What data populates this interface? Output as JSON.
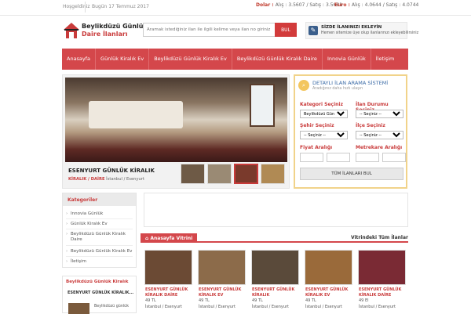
{
  "topbar": {
    "greeting": "Hoşgeldiniz",
    "date": "Bugün 17 Temmuz 2017",
    "dollar": {
      "label": "Dolar :",
      "buy_label": "Alış :",
      "buy": "3.5607",
      "sell_label": "/ Satış :",
      "sell": "3.5681"
    },
    "euro": {
      "label": "Euro :",
      "buy_label": "Alış :",
      "buy": "4.0644",
      "sell_label": "/ Satış :",
      "sell": "4.0744"
    }
  },
  "logo": {
    "line1": "Beylikdüzü Günlük",
    "line2": "Daire İlanları"
  },
  "search": {
    "placeholder": "Aramak istediğiniz ilan ile ilgili kelime veya ilan no giriniz",
    "button": "BUL"
  },
  "add_listing": {
    "title": "SİZDE İLANINIZI EKLEYİN",
    "text": "Hemen sitemize üye olup ilanlarınızı ekleyebilirsiniz"
  },
  "nav": [
    "Anasayfa",
    "Günlük Kiralık Ev",
    "Beylikdüzü Günlük Kiralık Ev",
    "Beylikdüzü Günlük Kiralık Daire",
    "Innovia Günlük",
    "İletişim"
  ],
  "slider": {
    "caption": "ESENYURT GÜNLÜK KİRALIK",
    "category": "KİRALIK / DAİRE",
    "location": "İstanbul / Esenyurt"
  },
  "detail_search": {
    "title": "DETAYLI İLAN ARAMA SİSTEMİ",
    "subtitle": "Aradığınız daha hızlı ulaşın",
    "kategori_label": "Kategori Seçiniz",
    "kategori_value": "Beylikdüzü Günlük",
    "durum_label": "İlan Durumu Seçiniz",
    "durum_value": "-- Seçiniz --",
    "sehir_label": "Şehir Seçiniz",
    "sehir_value": "-- Seçiniz --",
    "ilce_label": "İlçe Seçiniz",
    "ilce_value": "-- Seçiniz --",
    "fiyat_label": "Fiyat Aralığı",
    "metrekare_label": "Metrekare Aralığı",
    "button": "TÜM İLANLARI BUL"
  },
  "categories": {
    "title": "Kategoriler",
    "items": [
      "Innovia Günlük",
      "Günlük Kiralık Ev",
      "Beylikdüzü Günlük Kiralık Daire",
      "Beylikdüzü Günlük Kiralık Ev",
      "İletişim"
    ]
  },
  "small_box": {
    "title": "Beylikdüzü Günlük Kiralık",
    "name": "ESENYURT GÜNLÜK KİRALIK...",
    "desc": "Beylikdüzü günlük"
  },
  "vitrine": {
    "tab": "Anasayfa Vitrini",
    "all": "Vitrindeki Tüm İlanlar"
  },
  "cards": [
    {
      "name": "ESENYURT GÜNLÜK KİRALIK DAİRE",
      "price": "49 TL",
      "location": "İstanbul / Esenyurt",
      "color": "#6b4a34"
    },
    {
      "name": "ESENYURT GÜNLÜK KİRALIK EV",
      "price": "49 TL",
      "location": "İstanbul / Esenyurt",
      "color": "#8c6b4a"
    },
    {
      "name": "ESENYURT GÜNLÜK KİRALIK",
      "price": "49 TL",
      "location": "İstanbul / Esenyurt",
      "color": "#5a4a3a"
    },
    {
      "name": "ESENYURT GÜNLÜK KİRALIK EV",
      "price": "49 TL",
      "location": "İstanbul / Esenyurt",
      "color": "#9a6a3a"
    },
    {
      "name": "ESENYURT GÜNLÜK KİRALIK DAİRE",
      "price": "49 El",
      "location": "İstanbul / Esenyurt",
      "color": "#7a2a34"
    }
  ],
  "colors": {
    "accent": "#d4474b",
    "link_red": "#c93b3b",
    "search_border": "#f1d38a"
  }
}
